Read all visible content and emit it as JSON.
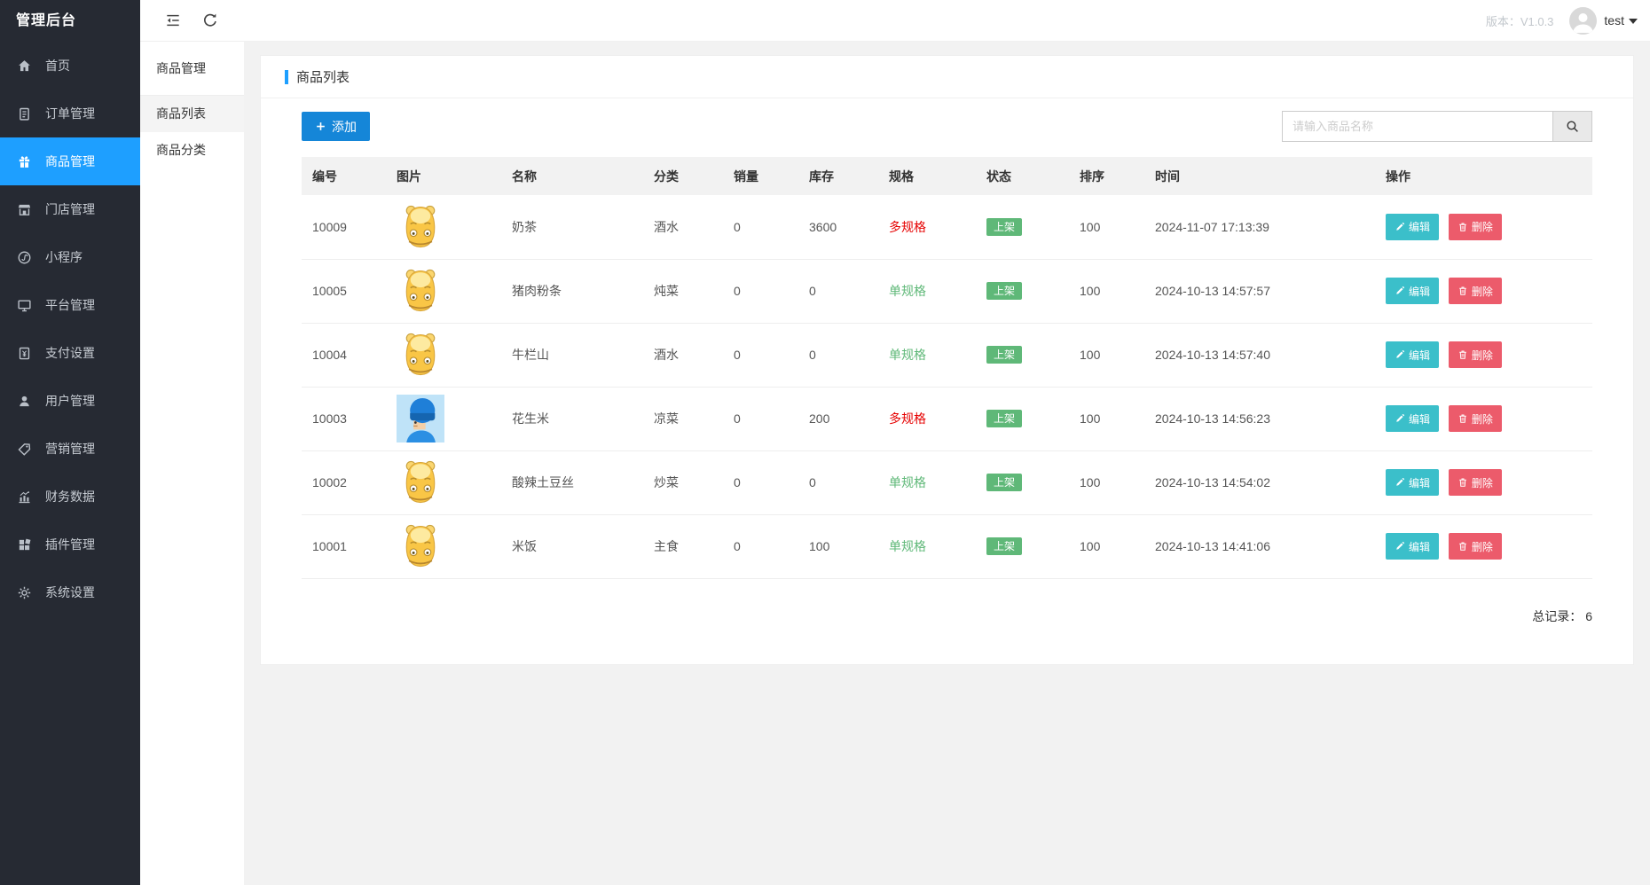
{
  "app": {
    "brand": "管理后台",
    "version_label": "版本：V1.0.3",
    "user": "test"
  },
  "sidebar": {
    "items": [
      {
        "label": "首页",
        "icon": "home-icon",
        "active": false
      },
      {
        "label": "订单管理",
        "icon": "order-icon",
        "active": false
      },
      {
        "label": "商品管理",
        "icon": "product-gift-icon",
        "active": true
      },
      {
        "label": "门店管理",
        "icon": "store-icon",
        "active": false
      },
      {
        "label": "小程序",
        "icon": "miniprogram-icon",
        "active": false
      },
      {
        "label": "平台管理",
        "icon": "platform-icon",
        "active": false
      },
      {
        "label": "支付设置",
        "icon": "payment-icon",
        "active": false
      },
      {
        "label": "用户管理",
        "icon": "users-icon",
        "active": false
      },
      {
        "label": "营销管理",
        "icon": "marketing-tag-icon",
        "active": false
      },
      {
        "label": "财务数据",
        "icon": "finance-chart-icon",
        "active": false
      },
      {
        "label": "插件管理",
        "icon": "plugins-icon",
        "active": false
      },
      {
        "label": "系统设置",
        "icon": "settings-gear-icon",
        "active": false
      }
    ]
  },
  "submenu": {
    "title": "商品管理",
    "items": [
      {
        "label": "商品列表",
        "active": true
      },
      {
        "label": "商品分类",
        "active": false
      }
    ]
  },
  "page": {
    "title": "商品列表",
    "add_label": "添加",
    "search_placeholder": "请输入商品名称",
    "total_label": "总记录：",
    "total": "6"
  },
  "table": {
    "headers": [
      "编号",
      "图片",
      "名称",
      "分类",
      "销量",
      "库存",
      "规格",
      "状态",
      "排序",
      "时间",
      "操作"
    ],
    "edit_label": "编辑",
    "delete_label": "删除",
    "rows": [
      {
        "id": "10009",
        "image": "hippo-cartoon-image",
        "name": "奶茶",
        "category": "酒水",
        "sales": "0",
        "stock": "3600",
        "spec": "多规格",
        "spec_type": "multi",
        "status": "上架",
        "sort": "100",
        "time": "2024-11-07 17:13:39"
      },
      {
        "id": "10005",
        "image": "hippo-cartoon-image",
        "name": "猪肉粉条",
        "category": "炖菜",
        "sales": "0",
        "stock": "0",
        "spec": "单规格",
        "spec_type": "single",
        "status": "上架",
        "sort": "100",
        "time": "2024-10-13 14:57:57"
      },
      {
        "id": "10004",
        "image": "hippo-cartoon-image",
        "name": "牛栏山",
        "category": "酒水",
        "sales": "0",
        "stock": "0",
        "spec": "单规格",
        "spec_type": "single",
        "status": "上架",
        "sort": "100",
        "time": "2024-10-13 14:57:40"
      },
      {
        "id": "10003",
        "image": "helmet-avatar-image",
        "name": "花生米",
        "category": "凉菜",
        "sales": "0",
        "stock": "200",
        "spec": "多规格",
        "spec_type": "multi",
        "status": "上架",
        "sort": "100",
        "time": "2024-10-13 14:56:23"
      },
      {
        "id": "10002",
        "image": "hippo-cartoon-image",
        "name": "酸辣土豆丝",
        "category": "炒菜",
        "sales": "0",
        "stock": "0",
        "spec": "单规格",
        "spec_type": "single",
        "status": "上架",
        "sort": "100",
        "time": "2024-10-13 14:54:02"
      },
      {
        "id": "10001",
        "image": "hippo-cartoon-image",
        "name": "米饭",
        "category": "主食",
        "sales": "0",
        "stock": "100",
        "spec": "单规格",
        "spec_type": "single",
        "status": "上架",
        "sort": "100",
        "time": "2024-10-13 14:41:06"
      }
    ]
  },
  "colors": {
    "sidebar_bg": "#262a33",
    "active_blue": "#1e9fff",
    "add_button_blue": "#1586d8",
    "edit_teal": "#3bbfca",
    "delete_red": "#ec5b6b",
    "status_green": "#5FB878",
    "multi_spec_red": "#e60000"
  }
}
